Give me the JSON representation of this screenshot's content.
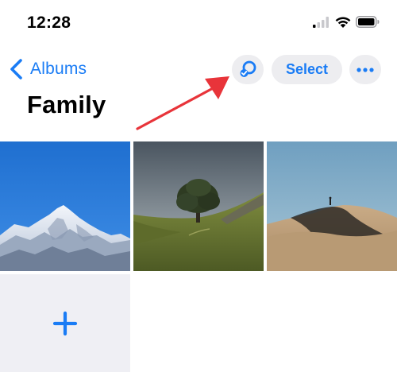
{
  "status_bar": {
    "time": "12:28",
    "icons": [
      "cellular-signal-icon",
      "wifi-icon",
      "battery-icon"
    ]
  },
  "nav": {
    "back_label": "Albums",
    "back_icon": "chevron-left-icon",
    "shared_icon": "shared-with-you-icon",
    "select_label": "Select",
    "more_icon": "ellipsis-icon"
  },
  "page": {
    "title": "Family"
  },
  "annotation": {
    "arrow_icon": "red-arrow-icon",
    "color": "#e8343a"
  },
  "grid": {
    "photos": [
      {
        "subject": "snowy mountain peak under blue sky"
      },
      {
        "subject": "single tree on grassy hill"
      },
      {
        "subject": "person standing on sand dune"
      }
    ],
    "add_icon": "plus-icon"
  },
  "colors": {
    "accent": "#1a7cf5",
    "button_bg": "#ededf0",
    "add_tile_bg": "#efeff4"
  }
}
